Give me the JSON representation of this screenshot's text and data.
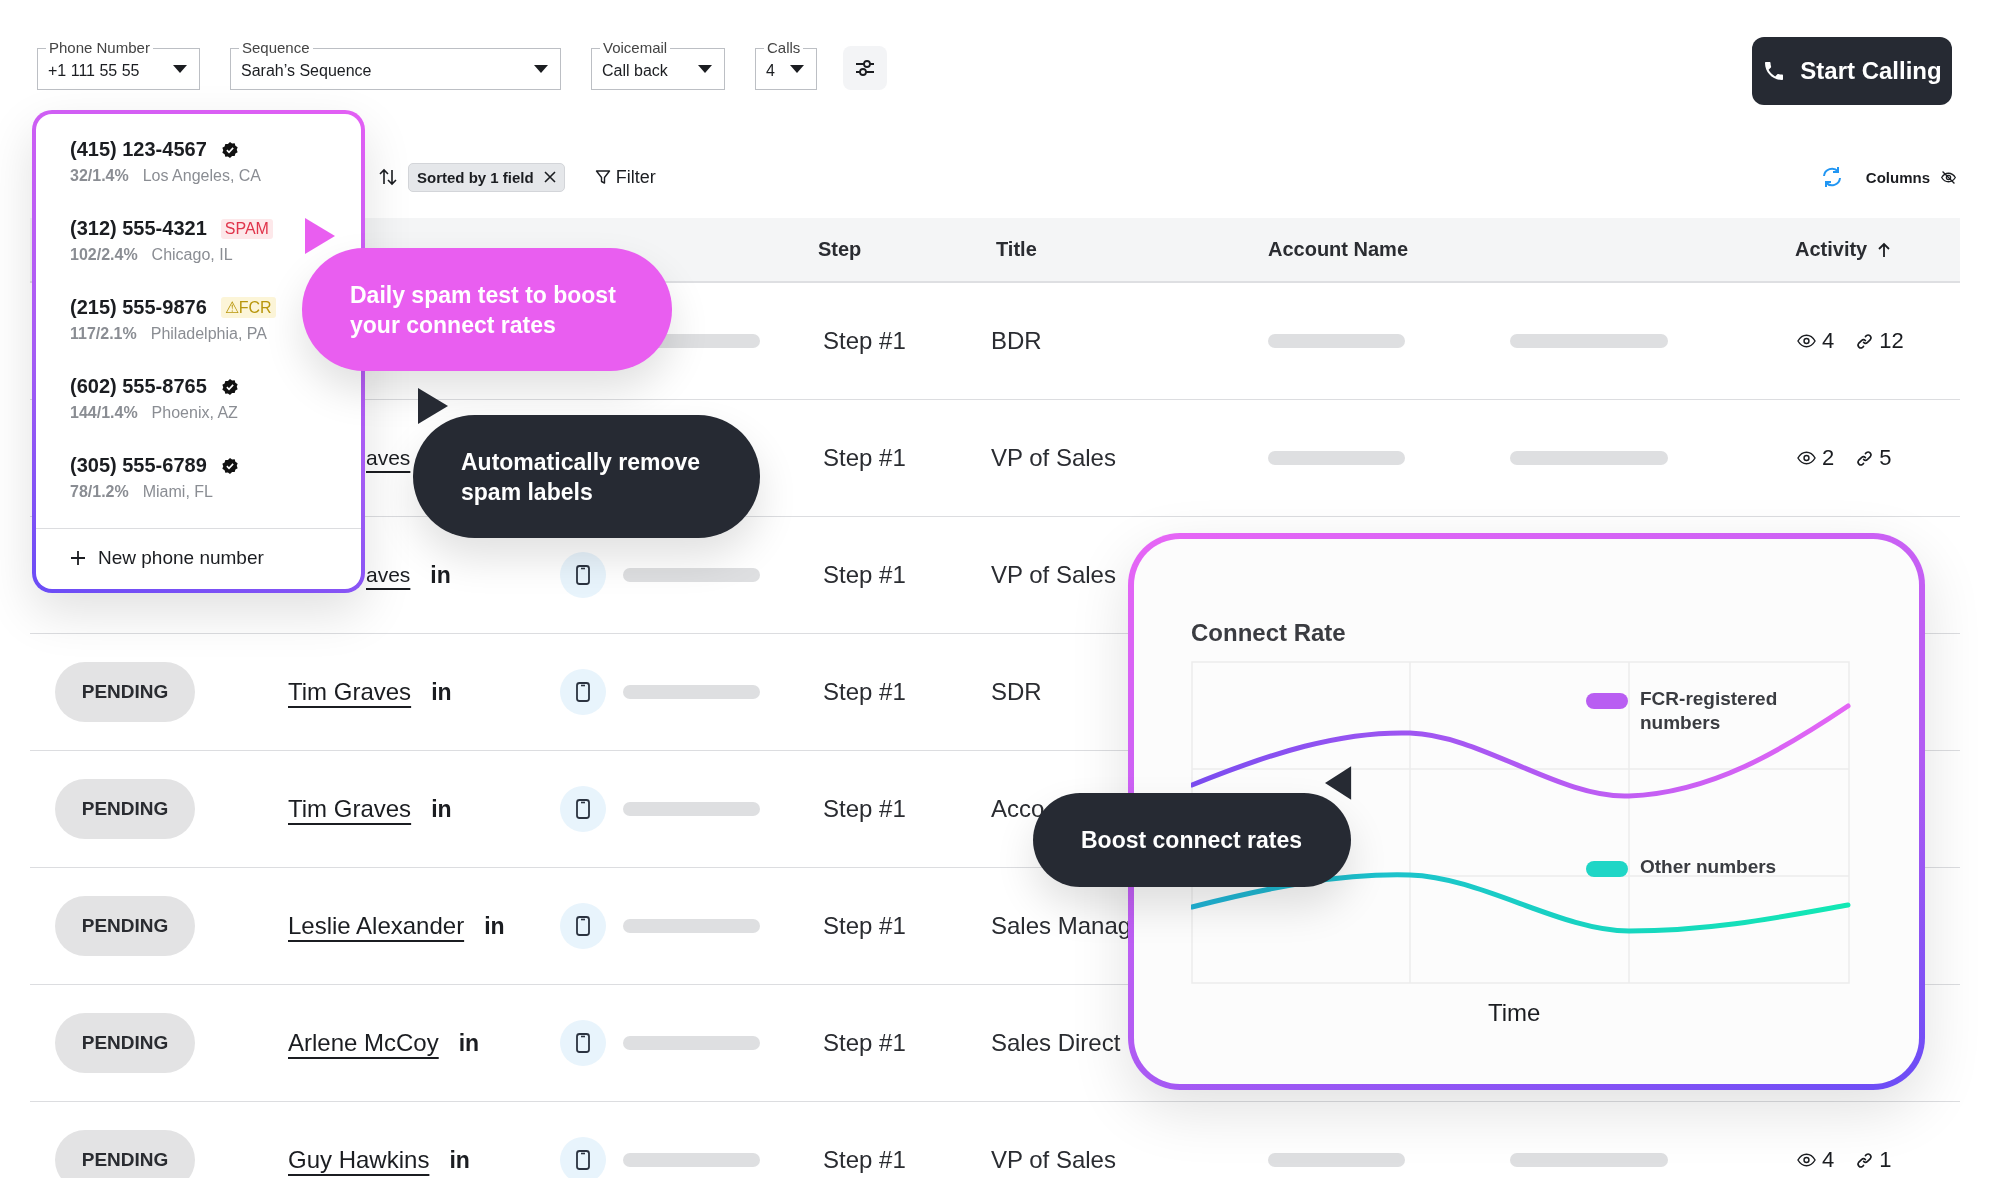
{
  "filters": [
    {
      "label": "Phone Number",
      "value": "+1 111 55 55"
    },
    {
      "label": "Sequence",
      "value": "Sarah’s Sequence"
    },
    {
      "label": "Voicemail",
      "value": "Call back"
    },
    {
      "label": "Calls",
      "value": "4"
    }
  ],
  "start_button": "Start Calling",
  "toolbar": {
    "sort_chip": "Sorted by 1 field",
    "filter": "Filter",
    "columns": "Columns"
  },
  "table": {
    "header": [
      {
        "label": "Step",
        "sorted": false
      },
      {
        "label": "Title",
        "sorted": false
      },
      {
        "label": "Account Name",
        "sorted": false
      },
      {
        "label": "Activity",
        "sorted": true
      }
    ],
    "rows": [
      {
        "cells": [
          "",
          "",
          "",
          {
            "kind": "contact_bar"
          },
          {
            "kind": "step",
            "text": "Step #1"
          },
          {
            "kind": "title",
            "text": "BDR"
          },
          {
            "kind": "account_bar"
          },
          {
            "kind": "owner_bar"
          },
          {
            "kind": "activity",
            "views": "4",
            "links": "12"
          }
        ]
      },
      {
        "cells": [
          "",
          {
            "kind": "contact",
            "name": "aves",
            "clipped": true
          },
          "",
          "",
          {
            "kind": "step",
            "text": "Step #1"
          },
          {
            "kind": "title",
            "text": "VP of Sales"
          },
          {
            "kind": "account_bar"
          },
          {
            "kind": "owner_bar"
          },
          {
            "kind": "activity",
            "views": "2",
            "links": "5"
          }
        ]
      },
      {
        "cells": [
          "",
          {
            "kind": "contact",
            "name": "aves",
            "clipped": true,
            "social": "in"
          },
          {
            "kind": "phone"
          },
          {
            "kind": "contact_bar"
          },
          {
            "kind": "step",
            "text": "Step #1"
          },
          {
            "kind": "title",
            "text": "VP of Sales"
          }
        ]
      },
      {
        "cells": [
          {
            "kind": "status",
            "text": "PENDING"
          },
          {
            "kind": "contact",
            "name": "Tim Graves",
            "social": "in"
          },
          {
            "kind": "phone"
          },
          {
            "kind": "contact_bar"
          },
          {
            "kind": "step",
            "text": "Step #1"
          },
          {
            "kind": "title",
            "text": "SDR"
          }
        ]
      },
      {
        "cells": [
          {
            "kind": "status",
            "text": "PENDING"
          },
          {
            "kind": "contact",
            "name": "Tim Graves",
            "social": "in"
          },
          {
            "kind": "phone"
          },
          {
            "kind": "contact_bar"
          },
          {
            "kind": "step",
            "text": "Step #1"
          },
          {
            "kind": "title",
            "text": "Acco"
          }
        ]
      },
      {
        "cells": [
          {
            "kind": "status",
            "text": "PENDING"
          },
          {
            "kind": "contact",
            "name": "Leslie Alexander",
            "social": "in"
          },
          {
            "kind": "phone"
          },
          {
            "kind": "contact_bar"
          },
          {
            "kind": "step",
            "text": "Step #1"
          },
          {
            "kind": "title",
            "text": "Sales Manag"
          }
        ]
      },
      {
        "cells": [
          {
            "kind": "status",
            "text": "PENDING"
          },
          {
            "kind": "contact",
            "name": "Arlene McCoy",
            "social": "in"
          },
          {
            "kind": "phone"
          },
          {
            "kind": "contact_bar"
          },
          {
            "kind": "step",
            "text": "Step #1"
          },
          {
            "kind": "title",
            "text": "Sales Direct"
          }
        ]
      },
      {
        "cells": [
          {
            "kind": "status",
            "text": "PENDING"
          },
          {
            "kind": "contact",
            "name": "Guy Hawkins",
            "social": "in"
          },
          {
            "kind": "phone"
          },
          {
            "kind": "contact_bar"
          },
          {
            "kind": "step",
            "text": "Step #1"
          },
          {
            "kind": "title",
            "text": "VP of Sales"
          },
          {
            "kind": "account_bar"
          },
          {
            "kind": "owner_bar"
          },
          {
            "kind": "activity",
            "views": "4",
            "links": "1"
          }
        ]
      }
    ]
  },
  "phone_menu": {
    "items": [
      {
        "number": "(415) 123-4567",
        "kind": "verified",
        "stats": "32/1.4%",
        "location": "Los Angeles, CA"
      },
      {
        "number": "(312) 555-4321",
        "kind": "spam",
        "badge": "SPAM",
        "stats": "102/2.4%",
        "location": "Chicago, IL"
      },
      {
        "number": "(215) 555-9876",
        "kind": "fcr",
        "badge": "⚠FCR",
        "stats": "117/2.1%",
        "location": "Philadelphia, PA"
      },
      {
        "number": "(602) 555-8765",
        "kind": "verified",
        "stats": "144/1.4%",
        "location": "Phoenix, AZ"
      },
      {
        "number": "(305) 555-6789",
        "kind": "verified",
        "stats": "78/1.2%",
        "location": "Miami, FL"
      }
    ],
    "add_label": "New phone number"
  },
  "callouts": [
    {
      "text": "Daily spam test to boost your connect rates",
      "kind": "accent"
    },
    {
      "text": "Automatically remove spam labels",
      "kind": "dark"
    },
    {
      "text": "Boost connect rates",
      "kind": "dark"
    }
  ],
  "chart_card": {
    "title": "Connect Rate",
    "xlabel": "Time",
    "legend": [
      {
        "label": "FCR-registered numbers",
        "color": "#b95ef2"
      },
      {
        "label": "Other numbers",
        "color": "#1fd6c6"
      }
    ]
  }
}
